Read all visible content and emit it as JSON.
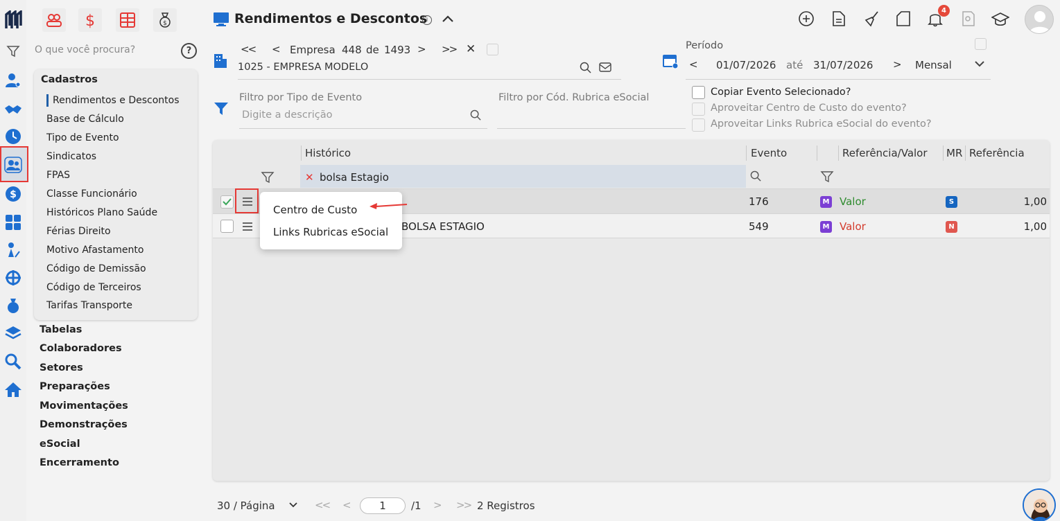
{
  "app": {
    "title": "Rendimentos e Descontos",
    "notification_count": "4"
  },
  "sidebar": {
    "search_placeholder": "O que você procura?",
    "section_title": "Cadastros",
    "sub_items": [
      "Rendimentos e Descontos",
      "Base de Cálculo",
      "Tipo de Evento",
      "Sindicatos",
      "FPAS",
      "Classe Funcionário",
      "Históricos Plano Saúde",
      "Férias Direito",
      "Motivo Afastamento",
      "Código de Demissão",
      "Código de Terceiros",
      "Tarifas Transporte"
    ],
    "groups": [
      "Tabelas",
      "Colaboradores",
      "Setores",
      "Preparações",
      "Movimentações",
      "Demonstrações",
      "eSocial",
      "Encerramento"
    ]
  },
  "company": {
    "label": "Empresa",
    "index": "448",
    "of_label": "de",
    "total": "1493",
    "name": "1025 - EMPRESA MODELO"
  },
  "period": {
    "label": "Período",
    "start": "01/07/2026",
    "until_label": "até",
    "end": "31/07/2026",
    "mode": "Mensal"
  },
  "filters": {
    "event_type_label": "Filtro por Tipo de Evento",
    "event_type_placeholder": "Digite a descrição",
    "rubrica_label": "Filtro por Cód. Rubrica eSocial",
    "options": [
      {
        "label": "Copiar Evento Selecionado?",
        "enabled": true,
        "checked": false
      },
      {
        "label": "Aproveitar Centro de Custo do evento?",
        "enabled": false,
        "checked": false
      },
      {
        "label": "Aproveitar Links Rubrica eSocial do evento?",
        "enabled": false,
        "checked": false
      }
    ]
  },
  "grid": {
    "headers": {
      "historico": "Histórico",
      "evento": "Evento",
      "ref_valor": "Referência/Valor",
      "mr": "MR",
      "referencia": "Referência"
    },
    "filter_value": "bolsa Estagio",
    "rows": [
      {
        "historico": "",
        "evento": "176",
        "tipo_badge": "M",
        "ref_valor": "Valor",
        "mr": "S",
        "referencia": "1,00",
        "checked": true
      },
      {
        "historico": "BOLSA ESTAGIO",
        "evento": "549",
        "tipo_badge": "M",
        "ref_valor": "Valor",
        "mr": "N",
        "referencia": "1,00",
        "checked": false
      }
    ]
  },
  "context_menu": {
    "items": [
      "Centro de Custo",
      "Links Rubricas eSocial"
    ]
  },
  "pagination": {
    "page_size": "30 / Página",
    "current_page": "1",
    "total_pages": "/1",
    "records": "2 Registros"
  },
  "colors": {
    "accent_blue": "#1f6fd0",
    "highlight_red": "#e53935",
    "value_green": "#2e8b2e",
    "value_red": "#d33b2c",
    "badge_purple": "#7b3fd4",
    "badge_blue": "#1565c0",
    "badge_red": "#e0574f"
  }
}
